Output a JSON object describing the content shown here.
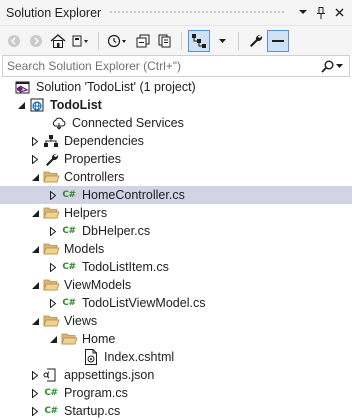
{
  "title": "Solution Explorer",
  "search": {
    "placeholder": "Search Solution Explorer (Ctrl+\")"
  },
  "tree": {
    "solution": "Solution 'TodoList' (1 project)",
    "project": "TodoList",
    "connected_services": "Connected Services",
    "dependencies": "Dependencies",
    "properties": "Properties",
    "controllers": "Controllers",
    "home_controller": "HomeController.cs",
    "helpers": "Helpers",
    "db_helper": "DbHelper.cs",
    "models": "Models",
    "todo_list_item": "TodoListItem.cs",
    "viewmodels": "ViewModels",
    "todo_list_viewmodel": "TodoListViewModel.cs",
    "views": "Views",
    "home": "Home",
    "index": "Index.cshtml",
    "appsettings": "appsettings.json",
    "program": "Program.cs",
    "startup": "Startup.cs",
    "cs_icon_text": "C#"
  },
  "colors": {
    "folder": "#dcb67a",
    "selected": "#d3d3e6",
    "csharp": "#2e8b2e",
    "solution": "#68217a",
    "accent": "#5a8fd6"
  },
  "icons": [
    "dropdown-icon",
    "pin-icon",
    "close-icon",
    "back-icon",
    "forward-icon",
    "home-icon",
    "history-icon",
    "collapse-all-icon",
    "show-all-files-icon",
    "sync-with-active-document-icon",
    "properties-wrench-icon",
    "preview-icon",
    "search-icon",
    "folder-icon",
    "csharp-file-icon"
  ]
}
